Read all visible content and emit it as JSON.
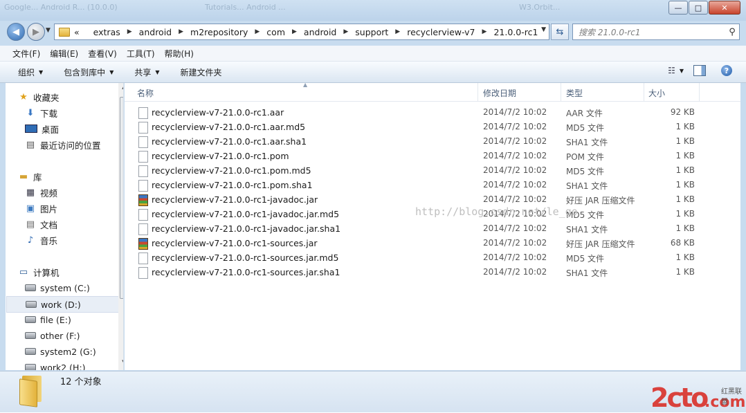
{
  "title_ghost": [
    "Google... Android R... (10.0.0)",
    "Tutorials... Android ...",
    "W3.Orbit..."
  ],
  "window_buttons": {
    "minimize": "—",
    "maximize": "□",
    "close": "✕"
  },
  "address": {
    "overflow": "«",
    "crumbs": [
      "extras",
      "android",
      "m2repository",
      "com",
      "android",
      "support",
      "recyclerview-v7",
      "21.0.0-rc1"
    ]
  },
  "search": {
    "placeholder": "搜索 21.0.0-rc1"
  },
  "menu": [
    "文件(F)",
    "编辑(E)",
    "查看(V)",
    "工具(T)",
    "帮助(H)"
  ],
  "toolbar": {
    "organize": "组织",
    "include": "包含到库中",
    "share": "共享",
    "new_folder": "新建文件夹",
    "help": "?"
  },
  "nav": {
    "favorites": "收藏夹",
    "fav_items": [
      "下载",
      "桌面",
      "最近访问的位置"
    ],
    "libraries": "库",
    "lib_items": [
      "视频",
      "图片",
      "文档",
      "音乐"
    ],
    "computer": "计算机",
    "drives": [
      "system (C:)",
      "work (D:)",
      "file (E:)",
      "other (F:)",
      "system2 (G:)",
      "work2 (H:)"
    ]
  },
  "columns": {
    "name": "名称",
    "date": "修改日期",
    "type": "类型",
    "size": "大小"
  },
  "files": [
    {
      "name": "recyclerview-v7-21.0.0-rc1.aar",
      "date": "2014/7/2 10:02",
      "type": "AAR 文件",
      "size": "92 KB",
      "kind": "file"
    },
    {
      "name": "recyclerview-v7-21.0.0-rc1.aar.md5",
      "date": "2014/7/2 10:02",
      "type": "MD5 文件",
      "size": "1 KB",
      "kind": "file"
    },
    {
      "name": "recyclerview-v7-21.0.0-rc1.aar.sha1",
      "date": "2014/7/2 10:02",
      "type": "SHA1 文件",
      "size": "1 KB",
      "kind": "file"
    },
    {
      "name": "recyclerview-v7-21.0.0-rc1.pom",
      "date": "2014/7/2 10:02",
      "type": "POM 文件",
      "size": "1 KB",
      "kind": "file"
    },
    {
      "name": "recyclerview-v7-21.0.0-rc1.pom.md5",
      "date": "2014/7/2 10:02",
      "type": "MD5 文件",
      "size": "1 KB",
      "kind": "file"
    },
    {
      "name": "recyclerview-v7-21.0.0-rc1.pom.sha1",
      "date": "2014/7/2 10:02",
      "type": "SHA1 文件",
      "size": "1 KB",
      "kind": "file"
    },
    {
      "name": "recyclerview-v7-21.0.0-rc1-javadoc.jar",
      "date": "2014/7/2 10:02",
      "type": "好压 JAR 压缩文件",
      "size": "1 KB",
      "kind": "jar"
    },
    {
      "name": "recyclerview-v7-21.0.0-rc1-javadoc.jar.md5",
      "date": "2014/7/2 10:02",
      "type": "MD5 文件",
      "size": "1 KB",
      "kind": "file"
    },
    {
      "name": "recyclerview-v7-21.0.0-rc1-javadoc.jar.sha1",
      "date": "2014/7/2 10:02",
      "type": "SHA1 文件",
      "size": "1 KB",
      "kind": "file"
    },
    {
      "name": "recyclerview-v7-21.0.0-rc1-sources.jar",
      "date": "2014/7/2 10:02",
      "type": "好压 JAR 压缩文件",
      "size": "68 KB",
      "kind": "jar"
    },
    {
      "name": "recyclerview-v7-21.0.0-rc1-sources.jar.md5",
      "date": "2014/7/2 10:02",
      "type": "MD5 文件",
      "size": "1 KB",
      "kind": "file"
    },
    {
      "name": "recyclerview-v7-21.0.0-rc1-sources.jar.sha1",
      "date": "2014/7/2 10:02",
      "type": "SHA1 文件",
      "size": "1 KB",
      "kind": "file"
    }
  ],
  "watermark": "http://blog.csdn.net/le_go",
  "status": {
    "count": "12 个对象"
  },
  "logo": {
    "main": "2cto",
    "tld": ".com",
    "tag": "红黑联盟"
  }
}
